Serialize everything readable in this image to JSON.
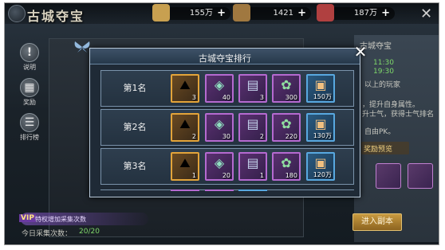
{
  "header": {
    "title": "古城夺宝",
    "resources": [
      {
        "value": "155万",
        "icon": "gold-ingot-icon",
        "color": "#c8a050"
      },
      {
        "value": "1421",
        "icon": "coin-bag-icon",
        "color": "#a07840"
      },
      {
        "value": "187万",
        "icon": "scroll-icon",
        "color": "#b04040"
      }
    ],
    "close": "✕"
  },
  "sidebar": {
    "items": [
      {
        "label": "说明",
        "icon": "!"
      },
      {
        "label": "奖励",
        "icon": "▦"
      },
      {
        "label": "排行榜",
        "icon": "☰"
      }
    ]
  },
  "right_panel": {
    "title": "古城夺宝",
    "time1": "11:30",
    "time2": "19:30",
    "line1": "以上的玩家",
    "line2": "，提升自身属性。",
    "line3": "升士气，获得士气排名",
    "line4": "自由PK。",
    "preview": "奖励预览",
    "enter_button": "进入副本"
  },
  "bottom": {
    "vip_badge": "VIP",
    "vip_text": "特权增加采集次数",
    "collect_label": "今日采集次数：",
    "collect_value": "20/20"
  },
  "modal": {
    "title": "古城夺宝排行",
    "close": "✕",
    "rows": [
      {
        "label": "第1名",
        "items": [
          {
            "qty": "3",
            "rarity": "gold",
            "icon": "treasure-chest-icon"
          },
          {
            "qty": "40",
            "rarity": "purple",
            "icon": "jade-gem-icon"
          },
          {
            "qty": "3",
            "rarity": "purple",
            "icon": "scroll-tablet-icon"
          },
          {
            "qty": "300",
            "rarity": "purple",
            "icon": "token-coin-icon"
          },
          {
            "qty": "150万",
            "rarity": "blue",
            "icon": "card-icon"
          }
        ]
      },
      {
        "label": "第2名",
        "items": [
          {
            "qty": "2",
            "rarity": "gold",
            "icon": "treasure-chest-icon"
          },
          {
            "qty": "30",
            "rarity": "purple",
            "icon": "jade-gem-icon"
          },
          {
            "qty": "2",
            "rarity": "purple",
            "icon": "scroll-tablet-icon"
          },
          {
            "qty": "220",
            "rarity": "purple",
            "icon": "token-coin-icon"
          },
          {
            "qty": "130万",
            "rarity": "blue",
            "icon": "card-icon"
          }
        ]
      },
      {
        "label": "第3名",
        "items": [
          {
            "qty": "1",
            "rarity": "gold",
            "icon": "treasure-chest-icon"
          },
          {
            "qty": "20",
            "rarity": "purple",
            "icon": "jade-gem-icon"
          },
          {
            "qty": "1",
            "rarity": "purple",
            "icon": "scroll-tablet-icon"
          },
          {
            "qty": "180",
            "rarity": "purple",
            "icon": "token-coin-icon"
          },
          {
            "qty": "120万",
            "rarity": "blue",
            "icon": "card-icon"
          }
        ]
      }
    ]
  }
}
